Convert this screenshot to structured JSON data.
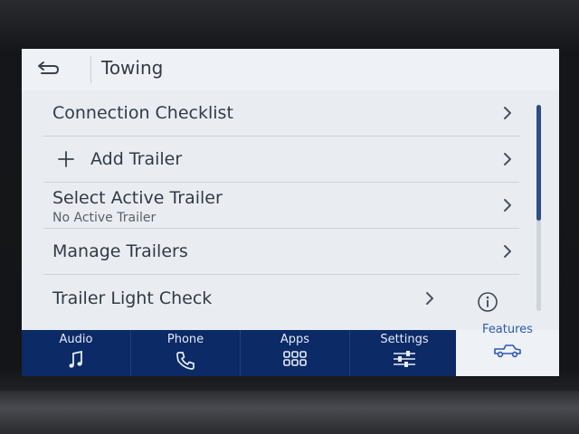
{
  "header": {
    "title": "Towing",
    "back_icon": "back-arrow-icon"
  },
  "list": {
    "items": [
      {
        "label": "Connection Checklist",
        "sublabel": ""
      },
      {
        "label": "Add Trailer",
        "sublabel": "",
        "prefix_icon": "plus-icon"
      },
      {
        "label": "Select Active Trailer",
        "sublabel": "No Active Trailer"
      },
      {
        "label": "Manage Trailers",
        "sublabel": ""
      },
      {
        "label": "Trailer Light Check",
        "sublabel": "",
        "extra_icon": "info-icon"
      }
    ]
  },
  "navbar": {
    "items": [
      {
        "label": "Audio",
        "icon": "music-note-icon"
      },
      {
        "label": "Phone",
        "icon": "phone-icon"
      },
      {
        "label": "Apps",
        "icon": "apps-grid-icon"
      },
      {
        "label": "Settings",
        "icon": "sliders-icon"
      },
      {
        "label": "Features",
        "icon": "truck-icon",
        "active": true
      }
    ]
  },
  "colors": {
    "nav_background": "#0b2a66",
    "screen_background": "#e9edf2",
    "active_accent": "#2c59b4",
    "scroll_thumb": "#2f4d86"
  }
}
